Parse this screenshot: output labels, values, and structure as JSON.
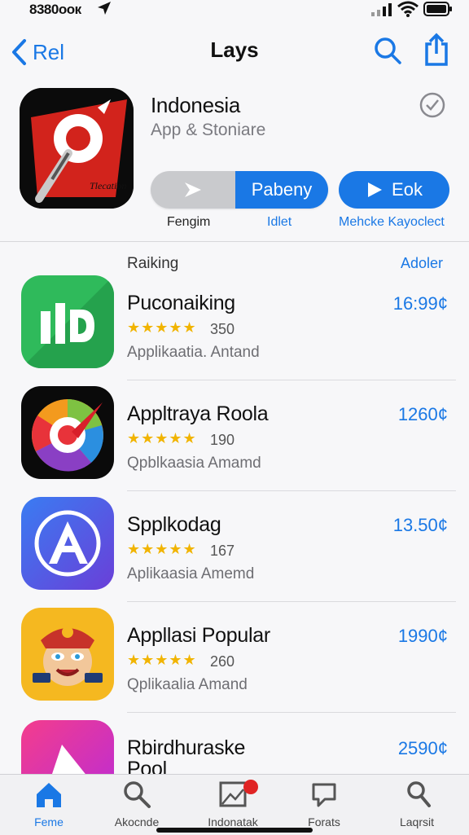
{
  "status_bar": {
    "time": "8380ooк",
    "icons": [
      "location-icon",
      "signal-icon",
      "wifi-icon",
      "battery-icon"
    ]
  },
  "nav": {
    "back_label": "Rel",
    "title": "Lays",
    "icons": [
      "search-icon",
      "share-icon"
    ]
  },
  "featured": {
    "name": "Indonesia",
    "subtitle": "App & Stoniare",
    "icon_text": "Tlecation",
    "segment_right_label": "Pabeny",
    "get_label": "Eok",
    "labels": [
      "Fengim",
      "Idlet",
      "Mehcke Kayoclect"
    ],
    "accent": "#1a78e5"
  },
  "section": {
    "title": "Raiking",
    "action": "Adoler"
  },
  "apps": [
    {
      "name": "Puconaiking",
      "rating": "★★★★★",
      "count": "350",
      "category": "Applikaatia. Antand",
      "price": "16:99¢"
    },
    {
      "name": "Appltraya Roola",
      "rating": "★★★★★",
      "count": "190",
      "category": "Qpblkaasia Amamd",
      "price": "1260¢"
    },
    {
      "name": "Spplkodag",
      "rating": "★★★★★",
      "count": "167",
      "category": "Aplikaasia Amemd",
      "price": "13.50¢"
    },
    {
      "name": "Appllasi Popular",
      "rating": "★★★★★",
      "count": "260",
      "category": "Qplikaalia Amand",
      "price": "1990¢"
    },
    {
      "name": "Rbirdhuraske",
      "subname": "Pool",
      "price": "2590¢"
    }
  ],
  "tabs": [
    {
      "label": "Feme",
      "icon": "home-icon",
      "active": true
    },
    {
      "label": "Akocnde",
      "icon": "search-icon",
      "active": false
    },
    {
      "label": "Indonatak",
      "icon": "gallery-icon",
      "active": false
    },
    {
      "label": "Forats",
      "icon": "chat-icon",
      "active": false
    },
    {
      "label": "Laqrsit",
      "icon": "profile-search-icon",
      "active": false
    }
  ]
}
